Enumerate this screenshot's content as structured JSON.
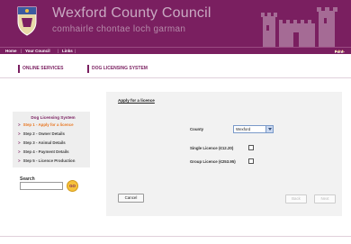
{
  "header": {
    "title": "Wexford County Council",
    "subtitle": "comhairle chontae loch garman"
  },
  "nav": {
    "items": [
      "Home",
      "Your Council",
      "Links"
    ],
    "font_size_label": "Font-size:",
    "font_size_glyphs": "A A A"
  },
  "tabs": [
    "ONLINE SERVICES",
    "DOG LICENSING SYSTEM"
  ],
  "sidebar": {
    "title": "Dog Licensing System",
    "steps": [
      "Step 1 - Apply for a licence",
      "Step 2 - Owner Details",
      "Step 3 - Animal Details",
      "Step 4 - Payment Details",
      "Step 5 - Licence Production"
    ],
    "active_step": 0,
    "step_arrow": ">"
  },
  "search": {
    "label": "Search",
    "value": "",
    "go_label": "GO"
  },
  "main": {
    "breadcrumb": "Apply for a licence",
    "county_label": "County",
    "county_value": "Wexford",
    "single_licence_label": "Single Licence (€12.20)",
    "group_licence_label": "Group Licence (€253.95)",
    "cancel_label": "Cancel",
    "back_label": "Back",
    "next_label": "Next"
  },
  "colors": {
    "brand": "#7a1f60",
    "active_step": "#e87722",
    "go_button": "#f6c13a"
  }
}
